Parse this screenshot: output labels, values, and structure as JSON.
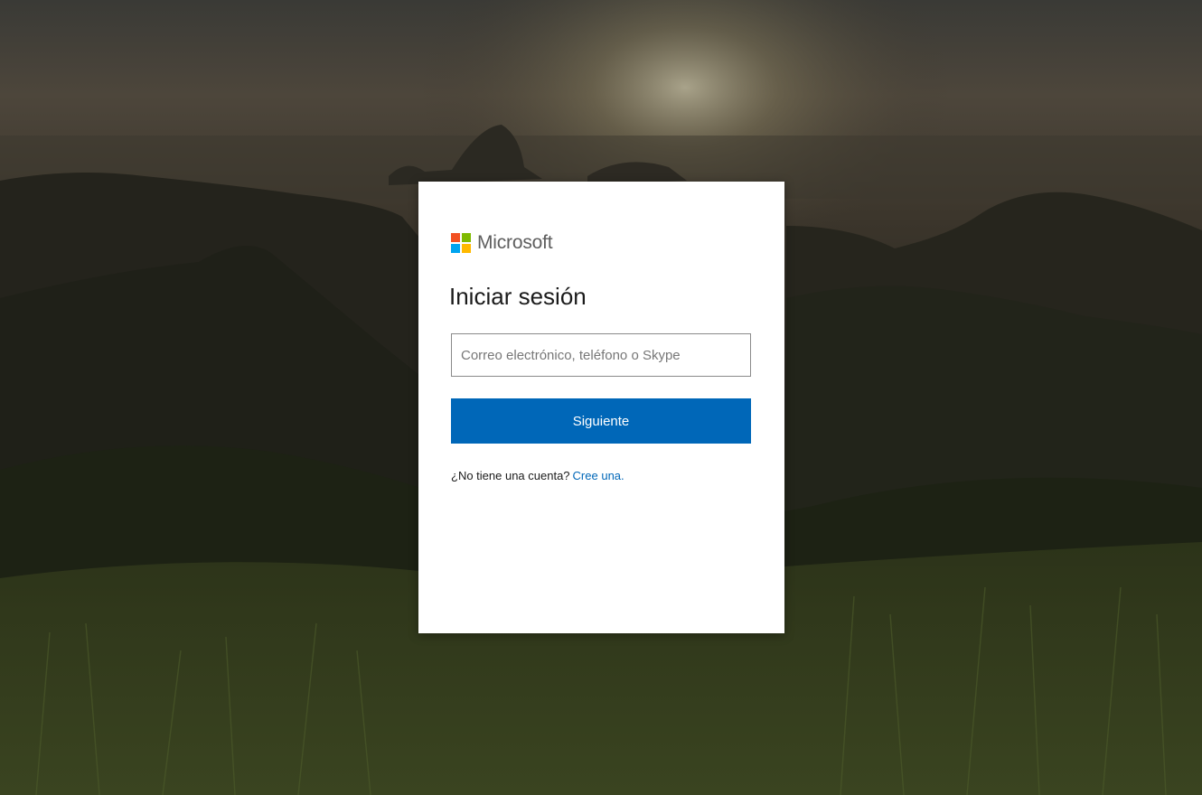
{
  "brand": {
    "name": "Microsoft",
    "logo_colors": [
      "#f25022",
      "#7fba00",
      "#00a4ef",
      "#ffb900"
    ],
    "logo_icon": "microsoft-logo-icon"
  },
  "signin": {
    "title": "Iniciar sesión",
    "email_placeholder": "Correo electrónico, teléfono o Skype",
    "email_value": "",
    "next_label": "Siguiente",
    "no_account_text": "¿No tiene una cuenta?",
    "create_link": "Cree una."
  },
  "colors": {
    "accent": "#0067b8",
    "card_bg": "#ffffff"
  }
}
